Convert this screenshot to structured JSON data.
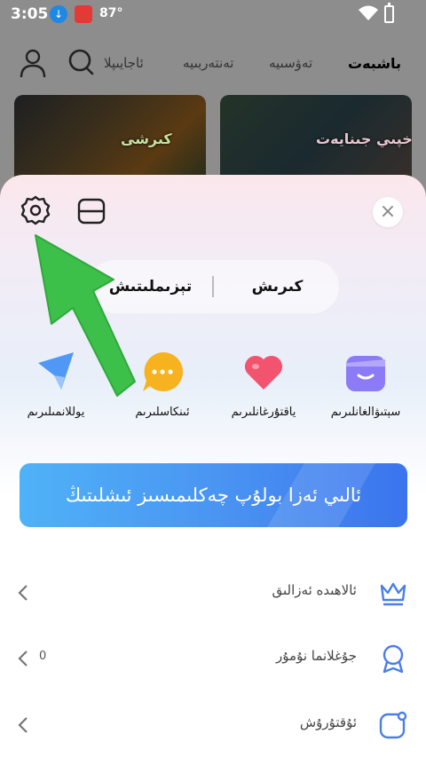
{
  "status_bar": {
    "time": "3:05",
    "temperature": "87°"
  },
  "top_nav": {
    "tabs": [
      {
        "label": "باشبەت"
      },
      {
        "label": "تەۋسىيە"
      },
      {
        "label": "تەنتەربىيە"
      },
      {
        "label": "ئاجايىپلا"
      }
    ]
  },
  "cards": [
    {
      "title": "كىرشى"
    },
    {
      "title": "مەخپىي جىنايەت"
    }
  ],
  "account_sheet": {
    "login_label": "كىرىش",
    "register_label": "تېزىملىتىش",
    "quick_actions": [
      {
        "label": "سېتىۋالغانلىرىم",
        "icon": "purchase-icon"
      },
      {
        "label": "ياقتۇرغانلىرىم",
        "icon": "heart-icon"
      },
      {
        "label": "ئىنكاسلىرىم",
        "icon": "comment-icon"
      },
      {
        "label": "يوللانمىلىرىم",
        "icon": "send-icon"
      }
    ],
    "banner_text": "ئالىي ئەزا بولۇپ چەكلىمىسىز ئىشلىتىڭ",
    "menu": [
      {
        "label": "ئالاھىدە ئەزالىق",
        "count": "",
        "icon": "crown-icon"
      },
      {
        "label": "جۇغلانما نۇمۇر",
        "count": "0",
        "icon": "medal-icon"
      },
      {
        "label": "ئۇقتۇرۇش",
        "count": "",
        "icon": "notification-icon"
      }
    ]
  },
  "colors": {
    "accent": "#4a95f2",
    "arrow": "#3cc04a"
  }
}
